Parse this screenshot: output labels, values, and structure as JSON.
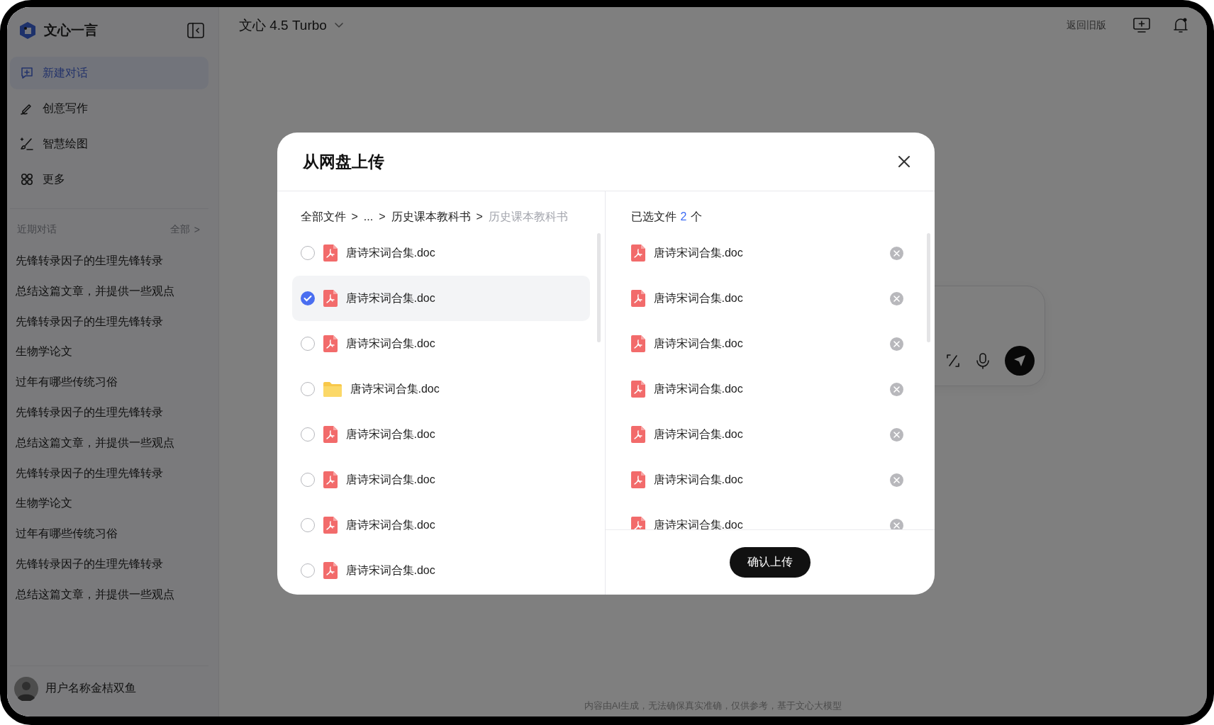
{
  "app": {
    "name": "文心一言"
  },
  "sidebar": {
    "nav": [
      {
        "label": "新建对话",
        "kind": "new",
        "selected": true
      },
      {
        "label": "创意写作",
        "kind": "write",
        "selected": false
      },
      {
        "label": "智慧绘图",
        "kind": "paint",
        "selected": false
      },
      {
        "label": "更多",
        "kind": "more",
        "selected": false
      }
    ],
    "recent_title": "近期对话",
    "recent_all": "全部",
    "recent_all_arrow": ">",
    "recent": [
      "先锋转录因子的生理先锋转录",
      "总结这篇文章，并提供一些观点",
      "先锋转录因子的生理先锋转录",
      "生物学论文",
      "过年有哪些传统习俗",
      "先锋转录因子的生理先锋转录",
      "总结这篇文章，并提供一些观点",
      "先锋转录因子的生理先锋转录",
      "生物学论文",
      "过年有哪些传统习俗",
      "先锋转录因子的生理先锋转录",
      "总结这篇文章，并提供一些观点"
    ],
    "user": {
      "name": "用户名称金桔双鱼"
    }
  },
  "header": {
    "model": "文心 4.5 Turbo",
    "back_link": "返回旧版"
  },
  "footer_note": "内容由AI生成，无法确保真实准确，仅供参考，基于文心大模型",
  "dialog": {
    "title": "从网盘上传",
    "breadcrumb": [
      {
        "label": "全部文件",
        "current": false
      },
      {
        "sep": ">",
        "label": "...",
        "current": false
      },
      {
        "sep": ">",
        "label": "历史课本教科书",
        "current": false
      },
      {
        "sep": ">",
        "label": "历史课本教科书",
        "current": true
      }
    ],
    "files": [
      {
        "name": "唐诗宋词合集.doc",
        "kind": "pdf",
        "selected": false
      },
      {
        "name": "唐诗宋词合集.doc",
        "kind": "pdf",
        "selected": true
      },
      {
        "name": "唐诗宋词合集.doc",
        "kind": "pdf",
        "selected": false
      },
      {
        "name": "唐诗宋词合集.doc",
        "kind": "folder",
        "selected": false
      },
      {
        "name": "唐诗宋词合集.doc",
        "kind": "pdf",
        "selected": false
      },
      {
        "name": "唐诗宋词合集.doc",
        "kind": "pdf",
        "selected": false
      },
      {
        "name": "唐诗宋词合集.doc",
        "kind": "pdf",
        "selected": false
      },
      {
        "name": "唐诗宋词合集.doc",
        "kind": "pdf",
        "selected": false
      }
    ],
    "selected_label": "已选文件",
    "selected_count": "2",
    "selected_unit": "个",
    "selected_files": [
      {
        "name": "唐诗宋词合集.doc",
        "kind": "pdf"
      },
      {
        "name": "唐诗宋词合集.doc",
        "kind": "pdf"
      },
      {
        "name": "唐诗宋词合集.doc",
        "kind": "pdf"
      },
      {
        "name": "唐诗宋词合集.doc",
        "kind": "pdf"
      },
      {
        "name": "唐诗宋词合集.doc",
        "kind": "pdf"
      },
      {
        "name": "唐诗宋词合集.doc",
        "kind": "pdf"
      },
      {
        "name": "唐诗宋词合集.doc",
        "kind": "pdf"
      }
    ],
    "confirm": "确认上传"
  }
}
